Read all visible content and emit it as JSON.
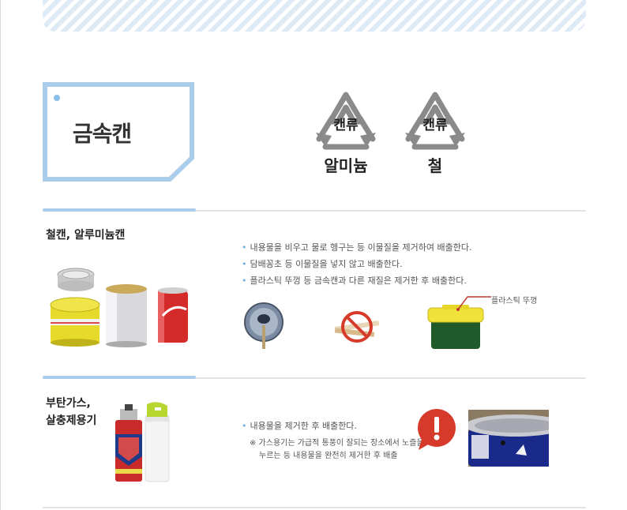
{
  "category_title": "금속캔",
  "recycle_marks": [
    {
      "inner": "캔류",
      "label": "알미늄",
      "icon": "recycle-aluminum-icon"
    },
    {
      "inner": "캔류",
      "label": "철",
      "icon": "recycle-steel-icon"
    }
  ],
  "sections": [
    {
      "title": "철캔, 알루미늄캔",
      "bullets": [
        "내용물을 비우고 물로 헹구는 등 이물질을 제거하여 배출한다.",
        "담배꽁초 등 이물질을 넣지 않고 배출한다.",
        "플라스틱 뚜껑 등 금속캔과 다른 재질은 제거한 후 배출한다."
      ],
      "callout": "플라스틱 뚜껑",
      "images": [
        "tuna-can",
        "yellow-tin",
        "silver-can",
        "cola-can",
        "can-tab",
        "no-cigarette-icon",
        "yellow-lid-container"
      ]
    },
    {
      "title_line1": "부탄가스,",
      "title_line2": "살충제용기",
      "bullets": [
        "내용물을 제거한 후 배출한다."
      ],
      "note_line1": "※ 가스용기는 가급적 통풍이 잘되는 장소에서 노즐을",
      "note_line2": "누르는 등 내용물을 완전히 제거한 후 배출",
      "images": [
        "butane-can",
        "spray-can",
        "warning-icon",
        "punctured-can-photo"
      ]
    }
  ],
  "colors": {
    "accent_blue": "#a9cdea",
    "recycle_gray": "#8a8a8a",
    "warning_red": "#d63a2a"
  }
}
